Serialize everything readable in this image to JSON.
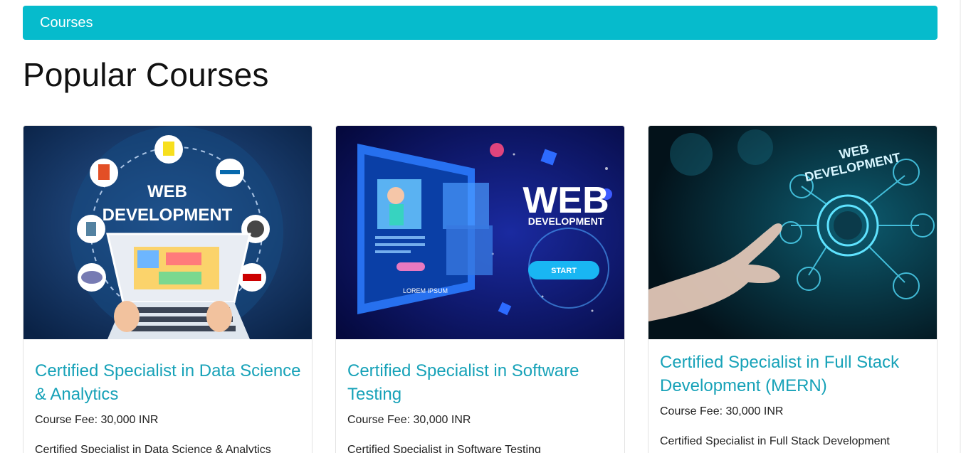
{
  "header": {
    "title": "Courses"
  },
  "page": {
    "heading": "Popular Courses"
  },
  "courses": [
    {
      "title": "Certified Specialist in Data Science & Analytics",
      "fee": "Course Fee: 30,000 INR",
      "description": "Certified Specialist in Data Science & Analytics",
      "image": {
        "line1": "WEB",
        "line2": "DEVELOPMENT",
        "badges": [
          "HTML 5",
          "JS",
          "jQuery",
          "WordPress",
          "php",
          "Java",
          "Ruby"
        ]
      }
    },
    {
      "title": "Certified Specialist in Software Testing",
      "fee": "Course Fee: 30,000 INR",
      "description": "Certified Specialist in Software Testing",
      "image": {
        "line1": "WEB",
        "line2": "DEVELOPMENT",
        "button": "START",
        "caption": "LOREM IPSUM"
      }
    },
    {
      "title": "Certified Specialist in Full Stack Development (MERN)",
      "fee": "Course Fee: 30,000 INR",
      "description": "Certified Specialist in Full Stack Development (MERN)",
      "image": {
        "line1": "WEB",
        "line2": "DEVELOPMENT"
      }
    }
  ],
  "colors": {
    "accent": "#06bbcc",
    "title_link": "#17a2b8"
  }
}
